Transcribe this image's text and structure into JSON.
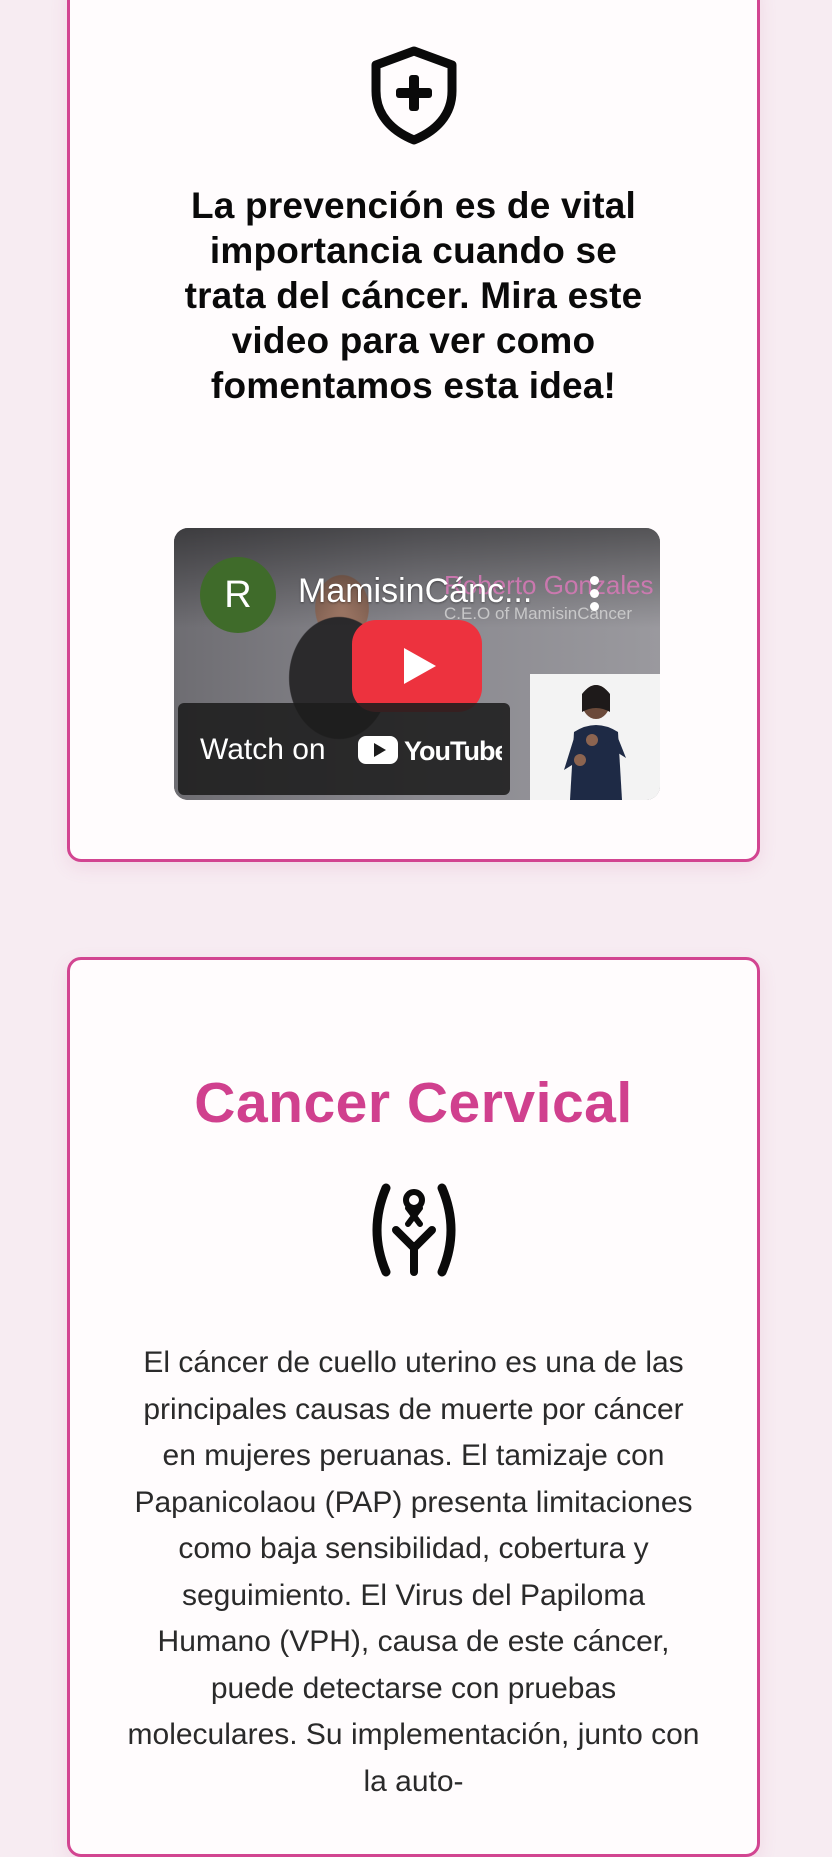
{
  "colors": {
    "page_background": "#f7ecf2",
    "accent_pink": "#d0408e",
    "card_border": "#d24591",
    "youtube_red": "#ed323e"
  },
  "prevention_card": {
    "icon": "shield-plus-icon",
    "heading": "La prevención es de vital importancia cuando se trata del cáncer. Mira este video para ver como fomentamos esta idea!",
    "video": {
      "channel_initial": "R",
      "title": "MamisinCánc...",
      "overlay_name": "Roberto Gonzales",
      "overlay_role": "C.E.O of MamisinCáncer",
      "watch_on_label": "Watch on",
      "platform_name": "YouTube",
      "more_icon": "more-vertical-icon",
      "play_icon": "youtube-play-icon"
    }
  },
  "cervical_card": {
    "title": "Cancer Cervical",
    "icon": "cervix-ribbon-icon",
    "body": "El cáncer de cuello uterino es una de las principales causas de muerte por cáncer en mujeres peruanas. El tamizaje con Papanicolaou (PAP) presenta limitaciones como baja sensibilidad, cobertura y seguimiento. El Virus del Papiloma Humano (VPH), causa de este cáncer, puede detectarse con pruebas moleculares. Su implementación, junto con la auto-"
  }
}
